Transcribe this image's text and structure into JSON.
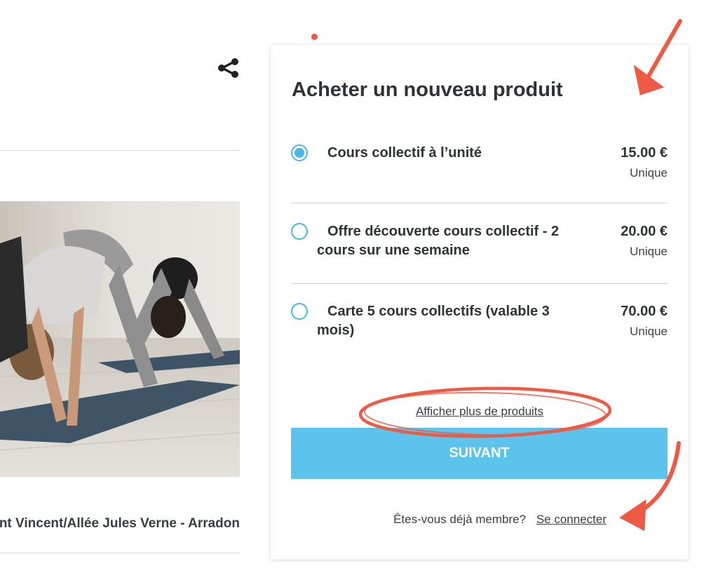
{
  "share": {
    "icon": "share-icon"
  },
  "listing": {
    "location": "Ti Chastel Saint Vincent/Allée Jules Verne - Arradon"
  },
  "purchase": {
    "title": "Acheter un nouveau produit",
    "products": [
      {
        "name": "Cours collectif à l’unité",
        "price": "15.00 €",
        "frequency": "Unique",
        "selected": true
      },
      {
        "name": "Offre découverte cours collectif - 2 cours sur une semaine",
        "price": "20.00 €",
        "frequency": "Unique",
        "selected": false
      },
      {
        "name": "Carte 5 cours collectifs (valable 3 mois)",
        "price": "70.00 €",
        "frequency": "Unique",
        "selected": false
      }
    ],
    "show_more_label": "Afficher plus de produits",
    "next_label": "SUIVANT",
    "member_question": "Êtes-vous déjà membre?",
    "login_label": "Se connecter"
  },
  "colors": {
    "accent": "#5bc3ec",
    "radio": "#45b8e6",
    "annotation": "#ef5a45"
  }
}
